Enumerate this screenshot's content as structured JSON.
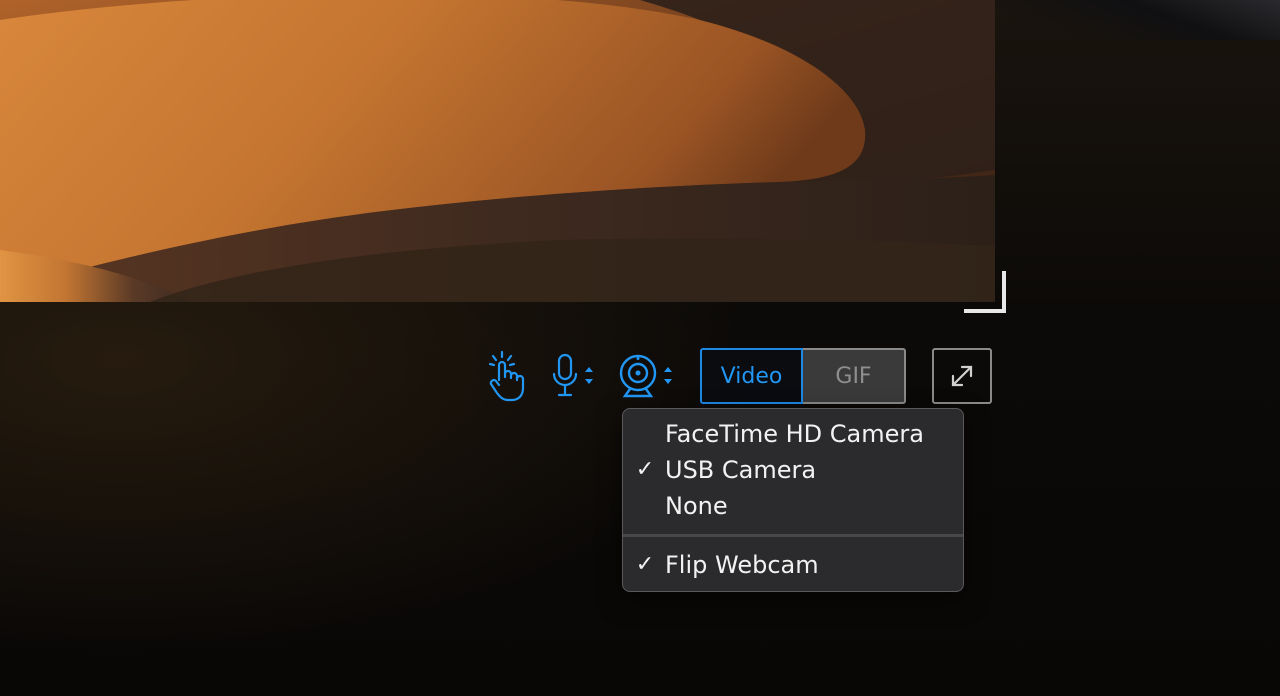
{
  "toolbar": {
    "touch_icon": "tap-gesture-icon",
    "mic_icon": "microphone-icon",
    "camera_icon": "webcam-icon",
    "stepper_icon": "up-down-chevron-icon",
    "expand_icon": "expand-arrows-icon",
    "accent_color": "#2196f3",
    "modes": {
      "video_label": "Video",
      "gif_label": "GIF",
      "selected": "Video"
    }
  },
  "camera_menu": {
    "check_glyph": "✓",
    "sources": [
      {
        "label": "FaceTime HD Camera",
        "checked": false
      },
      {
        "label": "USB Camera",
        "checked": true
      },
      {
        "label": "None",
        "checked": false
      }
    ],
    "options": [
      {
        "label": "Flip Webcam",
        "checked": true
      }
    ]
  }
}
